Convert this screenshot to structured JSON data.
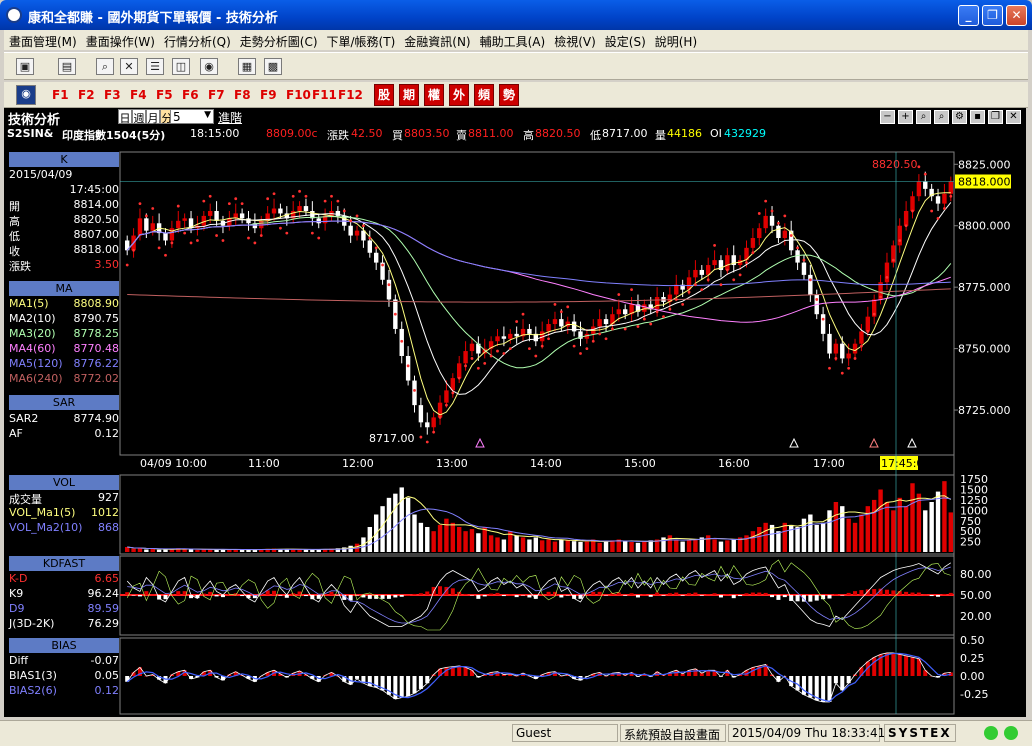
{
  "window": {
    "title": "康和全都賺 - 國外期貨下單報價 - 技術分析"
  },
  "menu": [
    "畫面管理(M)",
    "畫面操作(W)",
    "行情分析(Q)",
    "走勢分析圖(C)",
    "下單/帳務(T)",
    "金融資訊(N)",
    "輔助工具(A)",
    "檢視(V)",
    "設定(S)",
    "說明(H)"
  ],
  "fkeys": [
    "F1",
    "F2",
    "F3",
    "F4",
    "F5",
    "F6",
    "F7",
    "F8",
    "F9",
    "F10",
    "F11",
    "F12"
  ],
  "quickbuttons": [
    "股",
    "期",
    "權",
    "外",
    "頻",
    "勢"
  ],
  "header": {
    "title": "技術分析",
    "period_options": [
      "日",
      "週",
      "月",
      "分"
    ],
    "period_value": "5",
    "advanced": "進階"
  },
  "quote": {
    "symbol": "S2SIN&",
    "name": "印度指數1504(5分)",
    "time": "18:15:00",
    "price": "8809.00c",
    "chg_label": "漲跌",
    "chg": "42.50",
    "bid_label": "買",
    "bid": "8803.50",
    "ask_label": "賣",
    "ask": "8811.00",
    "high_label": "高",
    "high": "8820.50",
    "low_label": "低",
    "low": "8717.00",
    "vol_label": "量",
    "vol": "44186",
    "oi_label": "OI",
    "oi": "432929"
  },
  "panels": {
    "k": {
      "title": "K",
      "date": "2015/04/09",
      "time": "17:45:00",
      "rows": [
        [
          "開",
          "8814.00"
        ],
        [
          "高",
          "8820.50"
        ],
        [
          "低",
          "8807.00"
        ],
        [
          "收",
          "8818.00"
        ],
        [
          "漲跌",
          "3.50"
        ]
      ]
    },
    "ma": {
      "title": "MA",
      "rows": [
        [
          "MA1(5)",
          "8808.90"
        ],
        [
          "MA2(10)",
          "8790.75"
        ],
        [
          "MA3(20)",
          "8778.25"
        ],
        [
          "MA4(60)",
          "8770.48"
        ],
        [
          "MA5(120)",
          "8776.22"
        ],
        [
          "MA6(240)",
          "8772.02"
        ]
      ]
    },
    "sar": {
      "title": "SAR",
      "rows": [
        [
          "SAR2",
          "8774.90"
        ],
        [
          "AF",
          "0.12"
        ]
      ]
    },
    "vol": {
      "title": "VOL",
      "rows": [
        [
          "成交量",
          "927"
        ],
        [
          "VOL_Ma1(5)",
          "1012"
        ],
        [
          "VOL_Ma2(10)",
          "868"
        ]
      ]
    },
    "kd": {
      "title": "KDFAST",
      "rows": [
        [
          "K-D",
          "6.65"
        ],
        [
          "K9",
          "96.24"
        ],
        [
          "D9",
          "89.59"
        ],
        [
          "J(3D-2K)",
          "76.29"
        ]
      ]
    },
    "bias": {
      "title": "BIAS",
      "rows": [
        [
          "Diff",
          "-0.07"
        ],
        [
          "BIAS1(3)",
          "0.05"
        ],
        [
          "BIAS2(6)",
          "0.12"
        ]
      ]
    }
  },
  "axis": {
    "price_ticks": [
      "8825.000",
      "8800.000",
      "8775.000",
      "8750.000",
      "8725.000"
    ],
    "current_price": "8818.000",
    "time_labels": [
      "04/09 10:00",
      "11:00",
      "12:00",
      "13:00",
      "14:00",
      "15:00",
      "16:00",
      "17:00",
      "17:45:00"
    ],
    "vol_ticks": [
      "1750",
      "1500",
      "1250",
      "1000",
      "750",
      "500",
      "250"
    ],
    "kd_ticks": [
      "80.00",
      "50.00",
      "20.00"
    ],
    "bias_ticks": [
      "0.50",
      "0.25",
      "0.00",
      "-0.25"
    ],
    "high_mark": "8820.50",
    "low_mark": "8717.00"
  },
  "status": {
    "user": "Guest",
    "layout": "系統預設自設畫面",
    "datetime": "2015/04/09 Thu 18:33:41",
    "brand": "SYSTEX"
  },
  "colors": {
    "up": "#e00000",
    "down": "#ffffff",
    "bg": "#000000",
    "ma1": "#ffff80",
    "ma2": "#ffffff",
    "ma3": "#b0ffb0",
    "ma4": "#ff80ff",
    "ma5": "#8080ff",
    "ma6": "#c06060",
    "sar": "#ff3030"
  },
  "chart_data": {
    "type": "candlestick",
    "interval": "5min",
    "close": [
      8790,
      8796,
      8803,
      8798,
      8801,
      8797,
      8794,
      8799,
      8802,
      8803,
      8799,
      8800,
      8804,
      8806,
      8802,
      8800,
      8803,
      8805,
      8803,
      8801,
      8799,
      8802,
      8805,
      8807,
      8805,
      8803,
      8806,
      8808,
      8806,
      8803,
      8801,
      8804,
      8806,
      8804,
      8800,
      8796,
      8798,
      8794,
      8789,
      8785,
      8778,
      8770,
      8758,
      8747,
      8737,
      8727,
      8720,
      8718,
      8722,
      8728,
      8733,
      8738,
      8744,
      8749,
      8752,
      8748,
      8750,
      8753,
      8755,
      8754,
      8756,
      8755,
      8758,
      8756,
      8753,
      8757,
      8760,
      8762,
      8759,
      8761,
      8757,
      8754,
      8756,
      8759,
      8762,
      8760,
      8764,
      8766,
      8764,
      8768,
      8765,
      8768,
      8766,
      8771,
      8769,
      8772,
      8776,
      8774,
      8779,
      8782,
      8780,
      8784,
      8786,
      8782,
      8788,
      8784,
      8786,
      8791,
      8795,
      8799,
      8804,
      8800,
      8795,
      8798,
      8790,
      8785,
      8780,
      8772,
      8764,
      8756,
      8748,
      8752,
      8746,
      8748,
      8752,
      8757,
      8763,
      8770,
      8777,
      8785,
      8792,
      8800,
      8806,
      8812,
      8818,
      8815,
      8812,
      8809,
      8813,
      8818
    ],
    "price_range": [
      8712,
      8830
    ],
    "volume": [
      120,
      80,
      90,
      60,
      70,
      55,
      60,
      75,
      90,
      70,
      60,
      50,
      65,
      70,
      60,
      55,
      50,
      60,
      70,
      55,
      50,
      60,
      75,
      80,
      70,
      60,
      55,
      70,
      60,
      50,
      60,
      70,
      80,
      90,
      110,
      150,
      200,
      350,
      600,
      900,
      1100,
      1300,
      1400,
      1550,
      1300,
      900,
      700,
      600,
      500,
      650,
      800,
      700,
      600,
      500,
      550,
      450,
      600,
      400,
      350,
      300,
      500,
      400,
      350,
      300,
      350,
      280,
      300,
      250,
      300,
      280,
      260,
      240,
      250,
      300,
      220,
      250,
      280,
      300,
      260,
      240,
      220,
      260,
      280,
      300,
      350,
      400,
      300,
      250,
      280,
      300,
      350,
      400,
      300,
      250,
      280,
      300,
      350,
      400,
      500,
      600,
      700,
      650,
      500,
      700,
      650,
      600,
      800,
      900,
      650,
      700,
      1000,
      1200,
      1100,
      800,
      700,
      900,
      1100,
      1250,
      1500,
      1200,
      1000,
      1300,
      1100,
      1650,
      1400,
      1000,
      1200,
      1450,
      1700,
      950
    ],
    "k9": [
      70,
      60,
      55,
      75,
      65,
      45,
      40,
      55,
      70,
      75,
      50,
      45,
      60,
      70,
      55,
      50,
      60,
      65,
      55,
      45,
      40,
      55,
      70,
      75,
      60,
      50,
      65,
      75,
      60,
      45,
      40,
      55,
      65,
      55,
      35,
      25,
      40,
      30,
      20,
      15,
      10,
      5,
      5,
      5,
      10,
      15,
      20,
      30,
      55,
      70,
      80,
      85,
      80,
      75,
      70,
      55,
      60,
      70,
      75,
      65,
      70,
      60,
      65,
      55,
      45,
      60,
      70,
      75,
      55,
      60,
      45,
      40,
      55,
      65,
      70,
      60,
      70,
      75,
      65,
      75,
      60,
      70,
      60,
      75,
      65,
      75,
      80,
      70,
      80,
      85,
      75,
      80,
      85,
      70,
      80,
      65,
      70,
      80,
      85,
      88,
      90,
      75,
      60,
      65,
      45,
      35,
      25,
      15,
      10,
      8,
      5,
      20,
      15,
      25,
      35,
      45,
      55,
      65,
      75,
      80,
      85,
      88,
      90,
      92,
      95,
      90,
      85,
      80,
      90,
      96
    ],
    "d9": [
      62,
      61,
      59,
      64,
      64,
      58,
      52,
      53,
      59,
      64,
      59,
      54,
      56,
      61,
      59,
      56,
      57,
      60,
      58,
      54,
      49,
      51,
      57,
      63,
      62,
      58,
      60,
      65,
      63,
      57,
      51,
      52,
      56,
      56,
      49,
      41,
      41,
      37,
      31,
      26,
      21,
      16,
      12,
      10,
      10,
      12,
      15,
      20,
      32,
      45,
      57,
      66,
      71,
      72,
      71,
      66,
      64,
      66,
      69,
      68,
      69,
      66,
      66,
      62,
      56,
      57,
      61,
      66,
      62,
      61,
      56,
      51,
      52,
      56,
      61,
      61,
      64,
      68,
      67,
      70,
      67,
      68,
      65,
      68,
      67,
      70,
      73,
      72,
      75,
      78,
      77,
      78,
      80,
      77,
      78,
      74,
      73,
      75,
      78,
      81,
      84,
      81,
      74,
      71,
      62,
      53,
      44,
      34,
      26,
      20,
      15,
      17,
      16,
      19,
      24,
      31,
      39,
      48,
      57,
      65,
      72,
      77,
      81,
      85,
      88,
      89,
      88,
      85,
      87,
      90
    ],
    "bias1": [
      -0.08,
      0.05,
      0.12,
      0,
      0.02,
      -0.05,
      -0.1,
      0.02,
      0.06,
      0.08,
      -0.04,
      -0.02,
      0.06,
      0.08,
      -0.02,
      -0.06,
      0.02,
      0.06,
      0.01,
      -0.04,
      -0.08,
      0,
      0.05,
      0.08,
      0.03,
      -0.02,
      0.04,
      0.07,
      0.02,
      -0.04,
      -0.08,
      0.01,
      0.05,
      0,
      -0.08,
      -0.12,
      -0.04,
      -0.1,
      -0.14,
      -0.16,
      -0.2,
      -0.26,
      -0.32,
      -0.3,
      -0.28,
      -0.24,
      -0.18,
      -0.1,
      0.02,
      0.1,
      0.12,
      0.13,
      0.14,
      0.12,
      0.08,
      -0.02,
      0.02,
      0.05,
      0.06,
      0.02,
      0.03,
      0,
      0.04,
      0,
      -0.04,
      0.02,
      0.05,
      0.06,
      0,
      0.02,
      -0.04,
      -0.06,
      -0.01,
      0.03,
      0.05,
      0,
      0.04,
      0.05,
      0.01,
      0.05,
      -0.01,
      0.03,
      -0.01,
      0.06,
      0.01,
      0.05,
      0.08,
      0.03,
      0.08,
      0.1,
      0.04,
      0.08,
      0.08,
      -0.01,
      0.08,
      -0.02,
      0.02,
      0.08,
      0.12,
      0.14,
      0.16,
      0.02,
      -0.08,
      0,
      -0.14,
      -0.2,
      -0.26,
      -0.3,
      -0.34,
      -0.36,
      -0.36,
      -0.1,
      -0.2,
      -0.1,
      0.02,
      0.12,
      0.2,
      0.26,
      0.3,
      0.32,
      0.32,
      0.3,
      0.28,
      0.26,
      0.24,
      0.08,
      0,
      -0.02,
      0.04,
      0.05
    ]
  }
}
